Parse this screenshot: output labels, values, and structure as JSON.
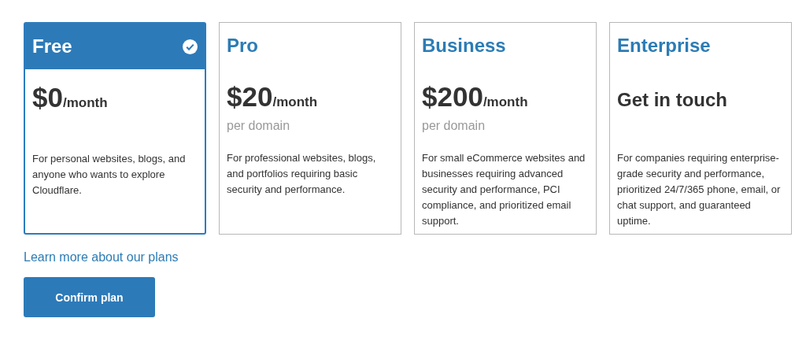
{
  "plans": [
    {
      "kind": "price",
      "name": "Free",
      "selected": true,
      "price": "$0",
      "period": "/month",
      "description": "For personal websites, blogs, and anyone who wants to explore Cloudflare."
    },
    {
      "kind": "price",
      "name": "Pro",
      "selected": false,
      "price": "$20",
      "period": "/month",
      "unit": "per domain",
      "description": "For professional websites, blogs, and portfolios requiring basic security and performance."
    },
    {
      "kind": "price",
      "name": "Business",
      "selected": false,
      "price": "$200",
      "period": "/month",
      "unit": "per domain",
      "description": "For small eCommerce websites and businesses requiring advanced security and performance, PCI compliance, and prioritized email support."
    },
    {
      "kind": "contact",
      "name": "Enterprise",
      "selected": false,
      "price": "Get in touch",
      "description": "For companies requiring enterprise-grade security and performance, prioritized 24/7/365 phone, email, or chat support, and guaranteed uptime."
    }
  ],
  "link": "Learn more about our plans",
  "button": "Confirm plan"
}
